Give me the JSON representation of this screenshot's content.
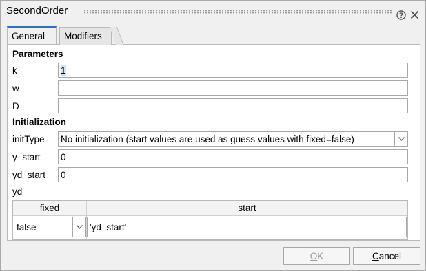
{
  "window": {
    "title": "SecondOrder"
  },
  "tabs": [
    {
      "label": "General"
    },
    {
      "label": "Modifiers"
    }
  ],
  "parameters": {
    "header": "Parameters",
    "k": {
      "label": "k",
      "value": "1"
    },
    "w": {
      "label": "w",
      "value": ""
    },
    "D": {
      "label": "D",
      "value": ""
    }
  },
  "initialization": {
    "header": "Initialization",
    "initType": {
      "label": "initType",
      "value": "No initialization (start values are used as guess values with fixed=false)"
    },
    "y_start": {
      "label": "y_start",
      "value": "0"
    },
    "yd_start": {
      "label": "yd_start",
      "value": "0"
    },
    "yd": {
      "label": "yd",
      "columns": [
        "fixed",
        "start"
      ],
      "row": {
        "fixed": "false",
        "start": "'yd_start'"
      }
    }
  },
  "buttons": {
    "ok_first": "O",
    "ok_rest": "K",
    "cancel_first": "C",
    "cancel_rest": "ancel"
  }
}
